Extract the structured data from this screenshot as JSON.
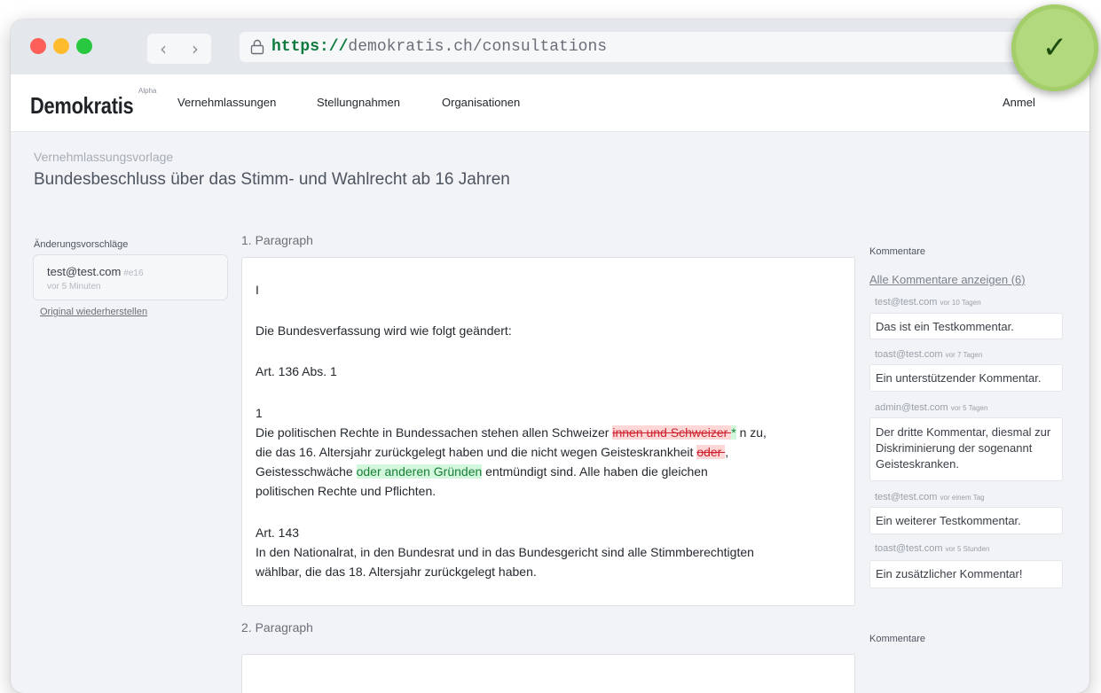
{
  "browser": {
    "url_protocol": "https://",
    "url_host": "demokratis.ch/consultations",
    "back_icon": "chevron-left-icon",
    "forward_icon": "chevron-right-icon",
    "lock_icon": "lock-icon"
  },
  "nav": {
    "logo": "Demokratis",
    "badge": "Alpha",
    "links": [
      "Vernehmlassungen",
      "Stellungnahmen",
      "Organisationen"
    ],
    "login": "Anmel"
  },
  "page": {
    "breadcrumb": "Vernehmlassungsvorlage",
    "title": "Bundesbeschluss über das Stimm- und Wahlrecht ab 16 Jahren"
  },
  "sidebar": {
    "heading": "Änderungsvorschläge",
    "change": {
      "user": "test@test.com",
      "id": "#e16",
      "time": "vor 5 Minuten"
    },
    "restore_link": "Original wiederherstellen"
  },
  "paragraphs": [
    {
      "heading": "1. Paragraph",
      "line_i": "I",
      "intro": "Die Bundesverfassung wird wie folgt geändert:",
      "art1_title": "Art. 136 Abs. 1",
      "art1_number": "1",
      "art1_p1": "Die politischen Rechte in Bundessachen stehen allen Schweizer ",
      "art1_del1": "innen und Schweizer ",
      "art1_ins1": "*",
      "art1_p2": " n zu,",
      "art1_p3": "die das 16. Altersjahr zurückgelegt haben und die nicht wegen Geisteskrankheit ",
      "art1_del2": "oder ",
      "art1_p4": ",",
      "art1_p5": "Geistesschwäche ",
      "art1_ins2": "oder anderen Gründen",
      "art1_p6": " entmündigt sind. Alle haben die gleichen",
      "art1_p7": "politischen Rechte und Pflichten.",
      "art2_title": "Art. 143",
      "art2_l1": "In den Nationalrat, in den Bundesrat und in das Bundesgericht sind alle Stimmberechtigten",
      "art2_l2": "wählbar, die das 18. Altersjahr zurückgelegt haben.",
      "comments_heading": "Kommentare",
      "comments_link": "Alle Kommentare anzeigen (6)",
      "comments": [
        {
          "user": "test@test.com",
          "time": "vor 10 Tagen",
          "text": "Das ist ein Testkommentar."
        },
        {
          "user": "toast@test.com",
          "time": "vor 7 Tagen",
          "text": "Ein unterstützender Kommentar."
        },
        {
          "user": "admin@test.com",
          "time": "vor 5 Tagen",
          "text": "Der dritte Kommentar, diesmal zur Diskriminierung der sogenannt Geisteskranken."
        },
        {
          "user": "test@test.com",
          "time": "vor einem Tag",
          "text": "Ein weiterer Testkommentar."
        },
        {
          "user": "toast@test.com",
          "time": "vor 5 Stunden",
          "text": "Ein zusätzlicher Kommentar!"
        }
      ]
    },
    {
      "heading": "2. Paragraph",
      "comments_heading": "Kommentare"
    }
  ],
  "overlay": {
    "badge_symbol": "✓",
    "badge_color": "#b2d97d"
  }
}
